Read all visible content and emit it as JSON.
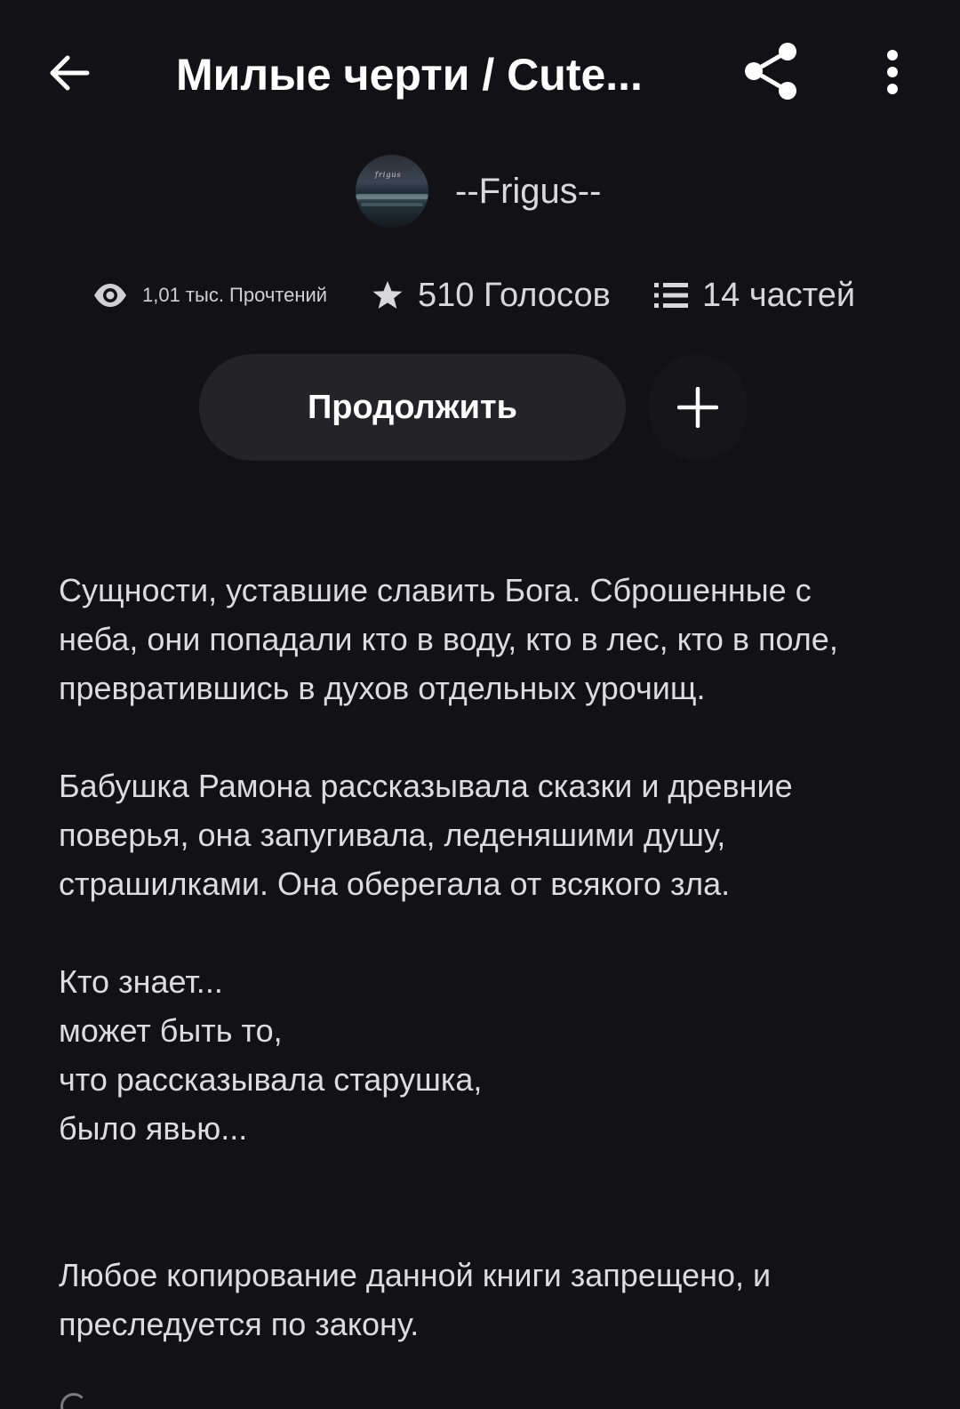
{
  "header": {
    "title": "Милые черти / Cute...",
    "back_icon": "arrow-left-icon",
    "share_icon": "share-icon",
    "more_icon": "more-vertical-icon"
  },
  "author": {
    "name": "--Frigus--",
    "avatar_icon": "avatar-sea-image"
  },
  "stats": {
    "reads": "1,01 тыс. Прочтений",
    "votes": "510 Голосов",
    "parts": "14 частей",
    "reads_icon": "eye-icon",
    "votes_icon": "star-icon",
    "parts_icon": "list-icon"
  },
  "actions": {
    "continue_label": "Продолжить",
    "add_icon": "plus-icon"
  },
  "description": {
    "p1_lines": [
      "Сущности, уставшие  славить  Бога.   Сброшенные с",
      "неба,  они попадали кто в воду, кто в лес, кто в поле,",
      "превратившись в духов отдельных урочищ."
    ],
    "p2_lines": [
      "Бабушка Рамона рассказывала сказки и древние",
      "поверья, она запугивала, леденяшими душу,",
      "страшилками. Она оберегала от всякого зла."
    ],
    "p3_lines": [
      "Кто знает...",
      "может быть то,",
      "что рассказывала старушка,",
      "было явью..."
    ],
    "p4_lines": [
      "Любое копирование данной книги запрещено, и",
      "преследуется по закону."
    ]
  },
  "colors": {
    "background": "#121115",
    "button_bg": "#242328",
    "text_primary": "#ffffff",
    "text_secondary": "#dcdce0"
  }
}
